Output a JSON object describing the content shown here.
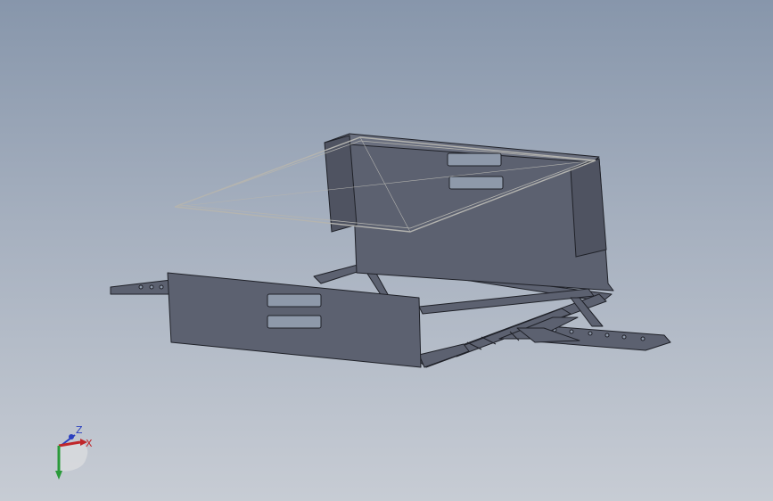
{
  "viewport": {
    "background_top": "#8796ab",
    "background_bottom": "#c7ccd4"
  },
  "model": {
    "face_color": "#5c6170",
    "face_dark": "#4a4e5b",
    "edge_color": "#1f2128",
    "sketch_color": "#b4b4b0",
    "slot_fill": "#8e99aa"
  },
  "triad": {
    "x_label": "X",
    "z_label": "Z",
    "x_color": "#c0262a",
    "y_color": "#2a9a3a",
    "z_color": "#2a3fbf"
  }
}
